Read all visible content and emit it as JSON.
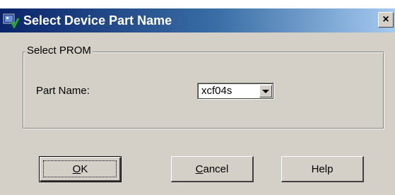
{
  "window": {
    "title": "Select Device Part Name",
    "close_label": "×"
  },
  "group": {
    "legend": "Select PROM"
  },
  "part": {
    "label": "Part Name:",
    "selected": "xcf04s"
  },
  "buttons": {
    "ok": {
      "underline": "O",
      "rest": "K"
    },
    "cancel": {
      "underline": "C",
      "rest": "ancel"
    },
    "help": {
      "label": "Help"
    }
  }
}
